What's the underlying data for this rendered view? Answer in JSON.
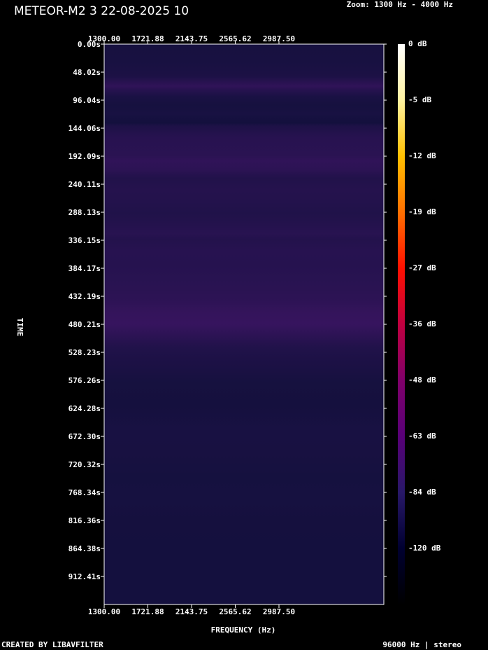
{
  "header": {
    "title": "METEOR-M2 3 22-08-2025 10",
    "zoom": "Zoom: 1300 Hz - 4000 Hz"
  },
  "footer": {
    "left": "CREATED BY LIBAVFILTER",
    "right": "96000 Hz | stereo"
  },
  "colors": {
    "background": "#000000",
    "plot_base": "#10103a",
    "band_purple": "#4a1670",
    "frame": "#ffffff"
  },
  "chart_data": {
    "type": "heatmap",
    "xlabel": "FREQUENCY (Hz)",
    "ylabel": "TIME",
    "x_ticks": [
      "1300.00",
      "1721.88",
      "2143.75",
      "2565.62",
      "2987.50"
    ],
    "x_tick_values": [
      1300.0,
      1721.88,
      2143.75,
      2565.62,
      2987.5
    ],
    "xlim": [
      1300,
      4000
    ],
    "y_ticks": [
      "0.00s",
      "48.02s",
      "96.04s",
      "144.06s",
      "192.09s",
      "240.11s",
      "288.13s",
      "336.15s",
      "384.17s",
      "432.19s",
      "480.21s",
      "528.23s",
      "576.26s",
      "624.28s",
      "672.30s",
      "720.32s",
      "768.34s",
      "816.36s",
      "864.38s",
      "912.41s"
    ],
    "y_tick_values": [
      0.0,
      48.02,
      96.04,
      144.06,
      192.09,
      240.11,
      288.13,
      336.15,
      384.17,
      432.19,
      480.21,
      528.23,
      576.26,
      624.28,
      672.3,
      720.32,
      768.34,
      816.36,
      864.38,
      912.41
    ],
    "ylim": [
      0,
      960.4
    ],
    "colorbar": {
      "labels": [
        "0 dB",
        "-5 dB",
        "-12 dB",
        "-19 dB",
        "-27 dB",
        "-36 dB",
        "-48 dB",
        "-63 dB",
        "-84 dB",
        "-120 dB"
      ],
      "values": [
        0,
        -5,
        -12,
        -19,
        -27,
        -36,
        -48,
        -63,
        -84,
        -120
      ],
      "stops": [
        "#ffffff",
        "#fff3a0",
        "#ffc000",
        "#ff7000",
        "#ff1000",
        "#c00040",
        "#80006a",
        "#580078",
        "#281868",
        "#000030",
        "#000000"
      ]
    },
    "intensity_profile": {
      "time_s": [
        0,
        30,
        55,
        72,
        78,
        90,
        105,
        120,
        135,
        140,
        160,
        190,
        200,
        215,
        230,
        250,
        270,
        290,
        310,
        325,
        335,
        355,
        380,
        400,
        420,
        440,
        460,
        480,
        500,
        520,
        540,
        560,
        580,
        620,
        660,
        700,
        740,
        780,
        820,
        880,
        960
      ],
      "level": [
        0.12,
        0.13,
        0.2,
        0.55,
        0.4,
        0.18,
        0.1,
        0.14,
        0.06,
        0.22,
        0.4,
        0.45,
        0.55,
        0.48,
        0.3,
        0.36,
        0.33,
        0.28,
        0.35,
        0.42,
        0.33,
        0.4,
        0.38,
        0.42,
        0.45,
        0.5,
        0.62,
        0.66,
        0.48,
        0.3,
        0.22,
        0.17,
        0.1,
        0.08,
        0.14,
        0.13,
        0.09,
        0.11,
        0.08,
        0.07,
        0.07
      ]
    }
  }
}
